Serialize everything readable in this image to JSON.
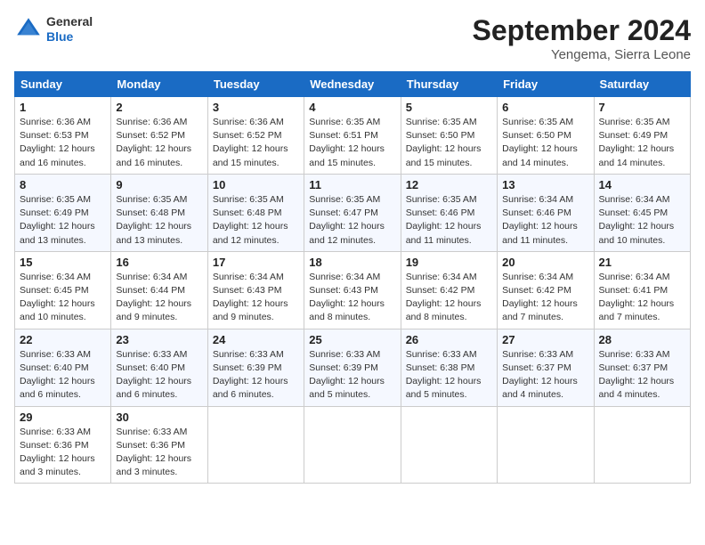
{
  "header": {
    "logo_general": "General",
    "logo_blue": "Blue",
    "month_title": "September 2024",
    "location": "Yengema, Sierra Leone"
  },
  "days_of_week": [
    "Sunday",
    "Monday",
    "Tuesday",
    "Wednesday",
    "Thursday",
    "Friday",
    "Saturday"
  ],
  "weeks": [
    [
      {
        "day": "1",
        "sunrise": "Sunrise: 6:36 AM",
        "sunset": "Sunset: 6:53 PM",
        "daylight": "Daylight: 12 hours and 16 minutes."
      },
      {
        "day": "2",
        "sunrise": "Sunrise: 6:36 AM",
        "sunset": "Sunset: 6:52 PM",
        "daylight": "Daylight: 12 hours and 16 minutes."
      },
      {
        "day": "3",
        "sunrise": "Sunrise: 6:36 AM",
        "sunset": "Sunset: 6:52 PM",
        "daylight": "Daylight: 12 hours and 15 minutes."
      },
      {
        "day": "4",
        "sunrise": "Sunrise: 6:35 AM",
        "sunset": "Sunset: 6:51 PM",
        "daylight": "Daylight: 12 hours and 15 minutes."
      },
      {
        "day": "5",
        "sunrise": "Sunrise: 6:35 AM",
        "sunset": "Sunset: 6:50 PM",
        "daylight": "Daylight: 12 hours and 15 minutes."
      },
      {
        "day": "6",
        "sunrise": "Sunrise: 6:35 AM",
        "sunset": "Sunset: 6:50 PM",
        "daylight": "Daylight: 12 hours and 14 minutes."
      },
      {
        "day": "7",
        "sunrise": "Sunrise: 6:35 AM",
        "sunset": "Sunset: 6:49 PM",
        "daylight": "Daylight: 12 hours and 14 minutes."
      }
    ],
    [
      {
        "day": "8",
        "sunrise": "Sunrise: 6:35 AM",
        "sunset": "Sunset: 6:49 PM",
        "daylight": "Daylight: 12 hours and 13 minutes."
      },
      {
        "day": "9",
        "sunrise": "Sunrise: 6:35 AM",
        "sunset": "Sunset: 6:48 PM",
        "daylight": "Daylight: 12 hours and 13 minutes."
      },
      {
        "day": "10",
        "sunrise": "Sunrise: 6:35 AM",
        "sunset": "Sunset: 6:48 PM",
        "daylight": "Daylight: 12 hours and 12 minutes."
      },
      {
        "day": "11",
        "sunrise": "Sunrise: 6:35 AM",
        "sunset": "Sunset: 6:47 PM",
        "daylight": "Daylight: 12 hours and 12 minutes."
      },
      {
        "day": "12",
        "sunrise": "Sunrise: 6:35 AM",
        "sunset": "Sunset: 6:46 PM",
        "daylight": "Daylight: 12 hours and 11 minutes."
      },
      {
        "day": "13",
        "sunrise": "Sunrise: 6:34 AM",
        "sunset": "Sunset: 6:46 PM",
        "daylight": "Daylight: 12 hours and 11 minutes."
      },
      {
        "day": "14",
        "sunrise": "Sunrise: 6:34 AM",
        "sunset": "Sunset: 6:45 PM",
        "daylight": "Daylight: 12 hours and 10 minutes."
      }
    ],
    [
      {
        "day": "15",
        "sunrise": "Sunrise: 6:34 AM",
        "sunset": "Sunset: 6:45 PM",
        "daylight": "Daylight: 12 hours and 10 minutes."
      },
      {
        "day": "16",
        "sunrise": "Sunrise: 6:34 AM",
        "sunset": "Sunset: 6:44 PM",
        "daylight": "Daylight: 12 hours and 9 minutes."
      },
      {
        "day": "17",
        "sunrise": "Sunrise: 6:34 AM",
        "sunset": "Sunset: 6:43 PM",
        "daylight": "Daylight: 12 hours and 9 minutes."
      },
      {
        "day": "18",
        "sunrise": "Sunrise: 6:34 AM",
        "sunset": "Sunset: 6:43 PM",
        "daylight": "Daylight: 12 hours and 8 minutes."
      },
      {
        "day": "19",
        "sunrise": "Sunrise: 6:34 AM",
        "sunset": "Sunset: 6:42 PM",
        "daylight": "Daylight: 12 hours and 8 minutes."
      },
      {
        "day": "20",
        "sunrise": "Sunrise: 6:34 AM",
        "sunset": "Sunset: 6:42 PM",
        "daylight": "Daylight: 12 hours and 7 minutes."
      },
      {
        "day": "21",
        "sunrise": "Sunrise: 6:34 AM",
        "sunset": "Sunset: 6:41 PM",
        "daylight": "Daylight: 12 hours and 7 minutes."
      }
    ],
    [
      {
        "day": "22",
        "sunrise": "Sunrise: 6:33 AM",
        "sunset": "Sunset: 6:40 PM",
        "daylight": "Daylight: 12 hours and 6 minutes."
      },
      {
        "day": "23",
        "sunrise": "Sunrise: 6:33 AM",
        "sunset": "Sunset: 6:40 PM",
        "daylight": "Daylight: 12 hours and 6 minutes."
      },
      {
        "day": "24",
        "sunrise": "Sunrise: 6:33 AM",
        "sunset": "Sunset: 6:39 PM",
        "daylight": "Daylight: 12 hours and 6 minutes."
      },
      {
        "day": "25",
        "sunrise": "Sunrise: 6:33 AM",
        "sunset": "Sunset: 6:39 PM",
        "daylight": "Daylight: 12 hours and 5 minutes."
      },
      {
        "day": "26",
        "sunrise": "Sunrise: 6:33 AM",
        "sunset": "Sunset: 6:38 PM",
        "daylight": "Daylight: 12 hours and 5 minutes."
      },
      {
        "day": "27",
        "sunrise": "Sunrise: 6:33 AM",
        "sunset": "Sunset: 6:37 PM",
        "daylight": "Daylight: 12 hours and 4 minutes."
      },
      {
        "day": "28",
        "sunrise": "Sunrise: 6:33 AM",
        "sunset": "Sunset: 6:37 PM",
        "daylight": "Daylight: 12 hours and 4 minutes."
      }
    ],
    [
      {
        "day": "29",
        "sunrise": "Sunrise: 6:33 AM",
        "sunset": "Sunset: 6:36 PM",
        "daylight": "Daylight: 12 hours and 3 minutes."
      },
      {
        "day": "30",
        "sunrise": "Sunrise: 6:33 AM",
        "sunset": "Sunset: 6:36 PM",
        "daylight": "Daylight: 12 hours and 3 minutes."
      },
      null,
      null,
      null,
      null,
      null
    ]
  ]
}
